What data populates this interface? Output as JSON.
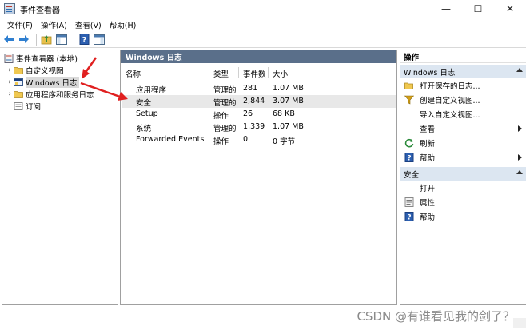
{
  "window": {
    "title": "事件查看器",
    "controls": [
      "—",
      "☐",
      "✕"
    ]
  },
  "menu": [
    "文件(F)",
    "操作(A)",
    "查看(V)",
    "帮助(H)"
  ],
  "tree": {
    "root": "事件查看器 (本地)",
    "items": [
      {
        "label": "自定义视图"
      },
      {
        "label": "Windows 日志"
      },
      {
        "label": "应用程序和服务日志"
      },
      {
        "label": "订阅"
      }
    ]
  },
  "middle": {
    "header": "Windows 日志",
    "columns": [
      "名称",
      "类型",
      "事件数",
      "大小"
    ],
    "rows": [
      {
        "name": "应用程序",
        "type": "管理的",
        "count": "281",
        "size": "1.07 MB"
      },
      {
        "name": "安全",
        "type": "管理的",
        "count": "2,844",
        "size": "3.07 MB"
      },
      {
        "name": "Setup",
        "type": "操作",
        "count": "26",
        "size": "68 KB"
      },
      {
        "name": "系统",
        "type": "管理的",
        "count": "1,339",
        "size": "1.07 MB"
      },
      {
        "name": "Forwarded Events",
        "type": "操作",
        "count": "0",
        "size": "0 字节"
      }
    ]
  },
  "actions": {
    "header": "操作",
    "section1": {
      "title": "Windows 日志",
      "items": [
        "打开保存的日志...",
        "创建自定义视图...",
        "导入自定义视图...",
        "查看",
        "刷新",
        "帮助"
      ]
    },
    "section2": {
      "title": "安全",
      "items": [
        "打开",
        "属性",
        "帮助"
      ]
    }
  },
  "watermark": "CSDN @有谁看见我的剑了？",
  "colors": {
    "pane_header": "#5a6f8a",
    "section_bg": "#dce6f1",
    "annotation_arrow": "#e02020"
  }
}
